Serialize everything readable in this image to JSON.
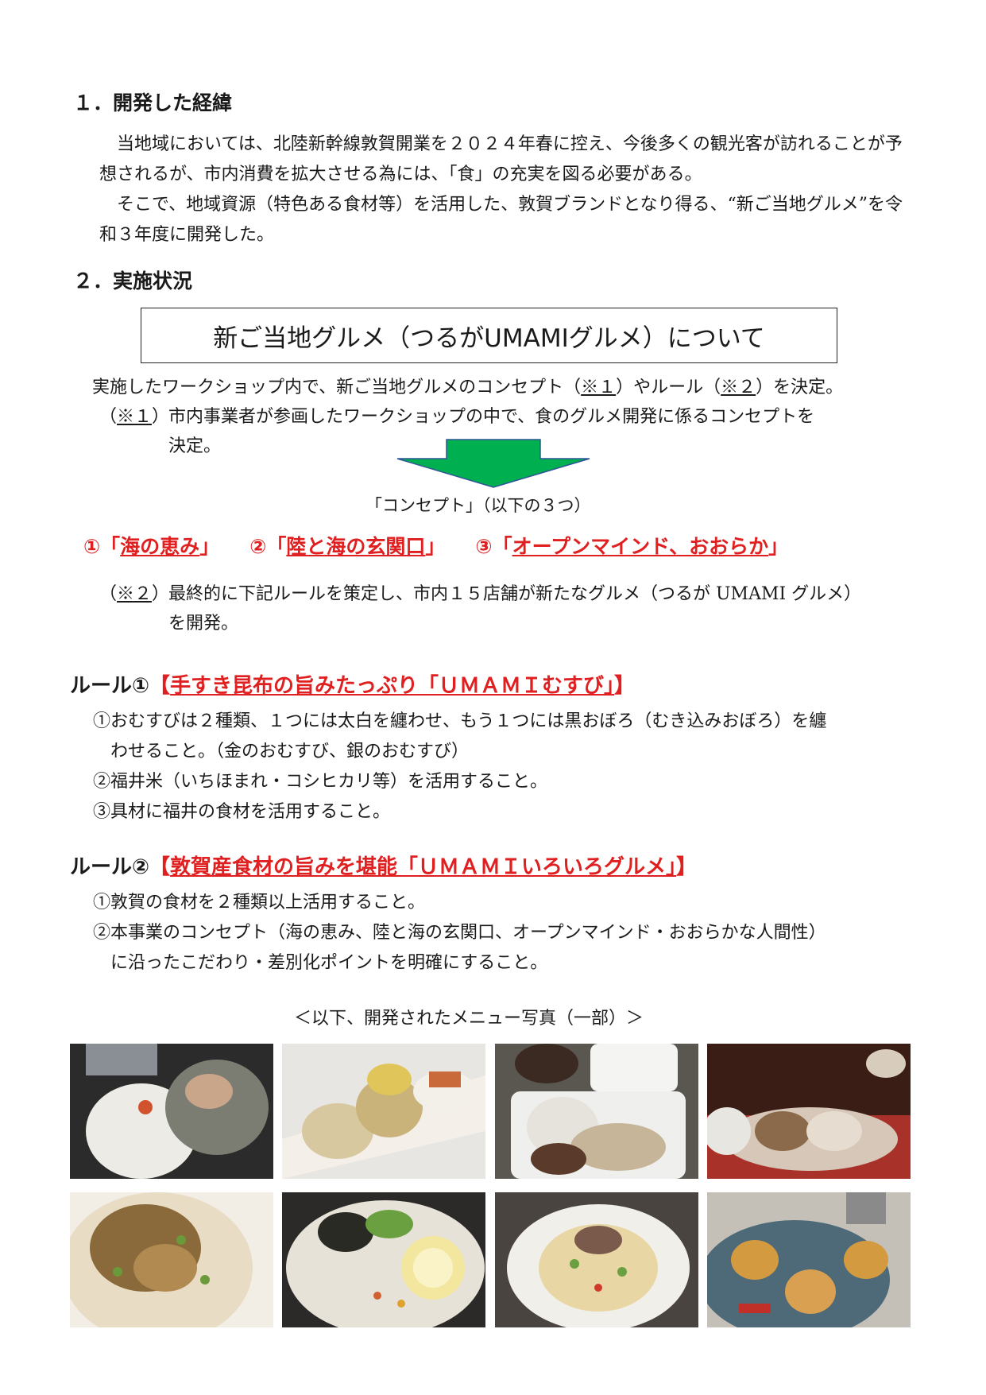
{
  "section1": {
    "heading": "１．開発した経緯",
    "para1": "　当地域においては、北陸新幹線敦賀開業を２０２４年春に控え、今後多くの観光客が訪れることが予想されるが、市内消費を拡大させる為には、「食」の充実を図る必要がある。",
    "para2": "　そこで、地域資源（特色ある食材等）を活用した、敦賀ブランドとなり得る、“新ご当地グルメ”を令和３年度に開発した。"
  },
  "section2": {
    "heading": "２．実施状況",
    "box_title": "新ご当地グルメ（つるがUMAMIグルメ）について",
    "intro_a": "実施したワークショップ内で、新ご当地グルメのコンセプト（",
    "intro_ref1": "※１",
    "intro_b": "）やルール（",
    "intro_ref2": "※２",
    "intro_c": "）を決定。",
    "note1_open": "（",
    "note1_ref": "※１",
    "note1_close": "）",
    "note1_line1": "市内事業者が参画したワークショップの中で、食のグルメ開発に係るコンセプトを",
    "note1_line2": "決定。",
    "concept_caption": "「コンセプト」（以下の３つ）",
    "concepts": [
      {
        "prefix": "①「",
        "text": "海の恵み",
        "suffix": "」"
      },
      {
        "prefix": "②「",
        "text": "陸と海の玄関口",
        "suffix": "」"
      },
      {
        "prefix": "③「",
        "text": "オープンマインド、おおらか",
        "suffix": "」"
      }
    ],
    "note2_open": "（",
    "note2_ref": "※２",
    "note2_close": "）",
    "note2_line1": "最終的に下記ルールを策定し、市内１５店舗が新たなグルメ（つるが UMAMI グルメ）",
    "note2_line2": "を開発。"
  },
  "rule1": {
    "label": "ルール①",
    "title_open": "【",
    "title": "手すき昆布の旨みたっぷり「ＵＭＡＭＩむすび」",
    "title_close": "】",
    "items": [
      "①おむすびは２種類、１つには太白を纏わせ、もう１つには黒おぼろ（むき込みおぼろ）を纏",
      "　わせること。（金のおむすび、銀のおむすび）",
      "②福井米（いちほまれ・コシヒカリ等）を活用すること。",
      "③具材に福井の食材を活用すること。"
    ]
  },
  "rule2": {
    "label": "ルール②",
    "title_open": "【",
    "title": "敦賀産食材の旨みを堪能「ＵＭＡＭＩいろいろグルメ」",
    "title_close": "】",
    "items": [
      "①敦賀の食材を２種類以上活用すること。",
      "②本事業のコンセプト（海の恵み、陸と海の玄関口、オープンマインド・おおらかな人間性）",
      "　に沿ったこだわり・差別化ポイントを明確にすること。"
    ]
  },
  "photos_caption": "＜以下、開発されたメニュー写真（一部）＞",
  "colors": {
    "accent_red": "#e02020",
    "arrow_green": "#00b050",
    "arrow_stroke": "#2f5597"
  }
}
